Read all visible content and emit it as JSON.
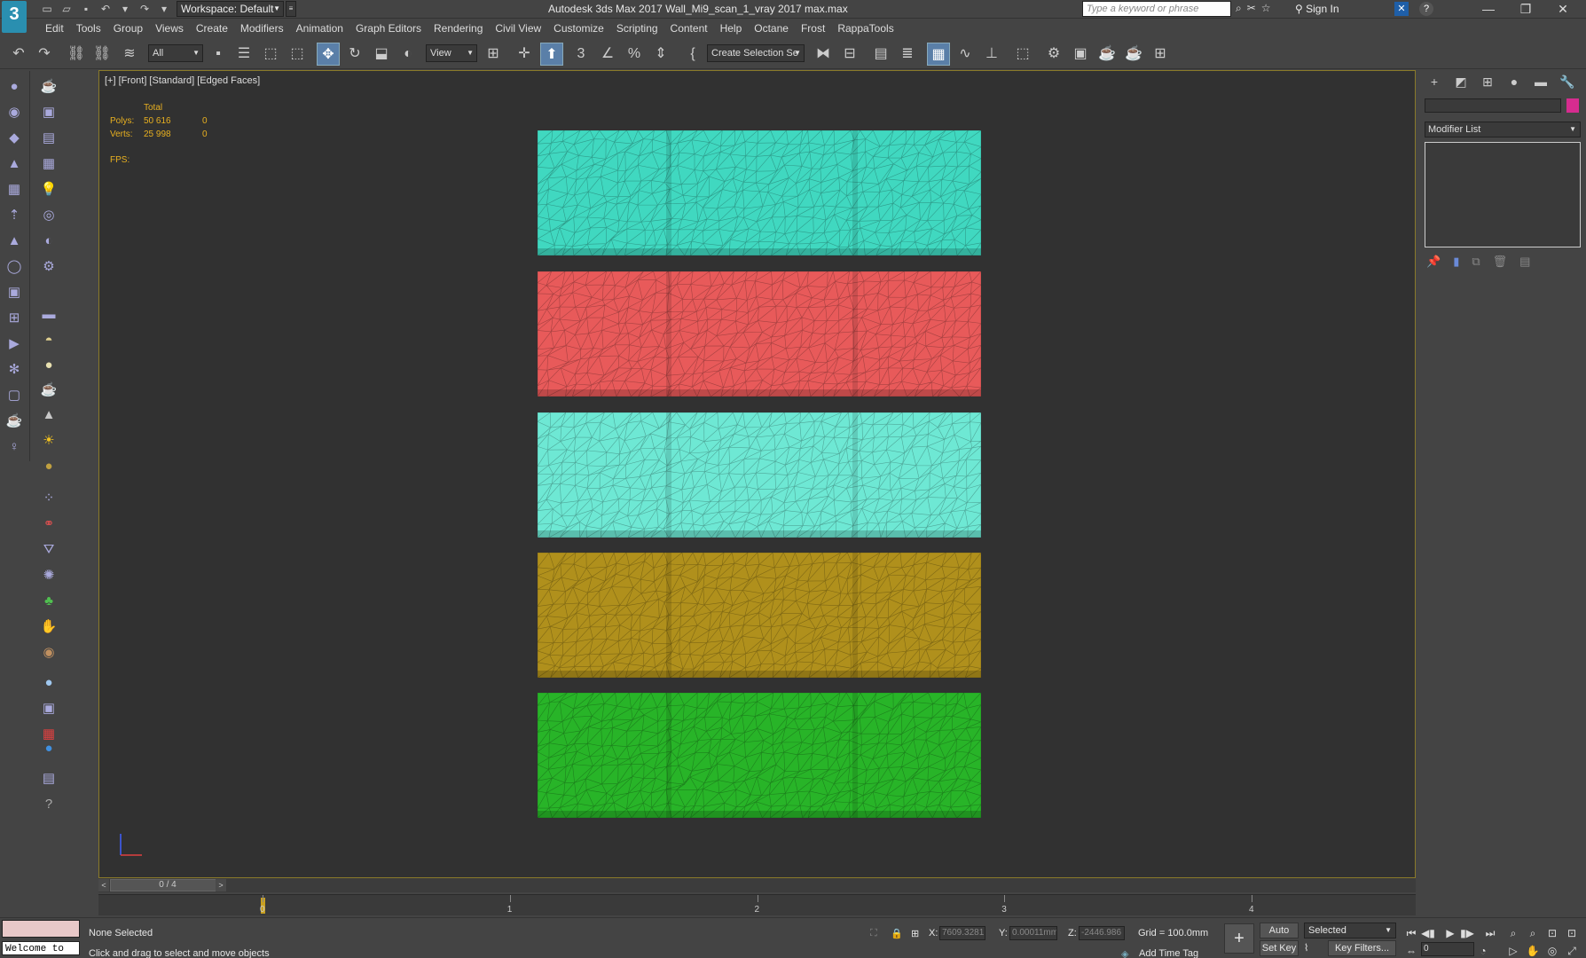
{
  "titlebar": {
    "workspace": "Workspace: Default",
    "title": "Autodesk 3ds Max 2017     Wall_Mi9_scan_1_vray 2017 max.max",
    "search_placeholder": "Type a keyword or phrase",
    "sign_in": "Sign In",
    "minimize": "—",
    "restore": "❐",
    "close": "✕",
    "app_logo": "3"
  },
  "menu": [
    "Edit",
    "Tools",
    "Group",
    "Views",
    "Create",
    "Modifiers",
    "Animation",
    "Graph Editors",
    "Rendering",
    "Civil View",
    "Customize",
    "Scripting",
    "Content",
    "Help",
    "Octane",
    "Frost",
    "RappaTools"
  ],
  "toolbar": {
    "filter": "All",
    "ref_coord": "View",
    "selection_set": "Create Selection Se"
  },
  "viewport": {
    "label": "[+] [Front] [Standard] [Edged Faces]",
    "stats_header": "Total",
    "polys_label": "Polys:",
    "polys_total": "50 616",
    "polys_sel": "0",
    "verts_label": "Verts:",
    "verts_total": "25 998",
    "verts_sel": "0",
    "fps_label": "FPS:",
    "panel_colors": [
      "#40d8c0",
      "#e85a5a",
      "#6ee8d4",
      "#b0901c",
      "#28b428"
    ]
  },
  "command_panel": {
    "modifier_list": "Modifier List",
    "object_color": "#d62c8f"
  },
  "timeline": {
    "frame_display": "0 / 4",
    "ticks": [
      "0",
      "1",
      "2",
      "3",
      "4"
    ],
    "current_frame": 0,
    "total_frames": 4
  },
  "status": {
    "welcome": "Welcome to M:",
    "selection": "None Selected",
    "prompt": "Click and drag to select and move objects",
    "x_label": "X:",
    "x_value": "7609.3281",
    "y_label": "Y:",
    "y_value": "0.00011mm",
    "z_label": "Z:",
    "z_value": "-2446.986",
    "grid": "Grid = 100.0mm",
    "add_time_tag": "Add Time Tag",
    "auto_key": "Auto Key",
    "set_key": "Set Key",
    "key_mode": "Selected",
    "key_filters": "Key Filters...",
    "frame_field": "0"
  }
}
